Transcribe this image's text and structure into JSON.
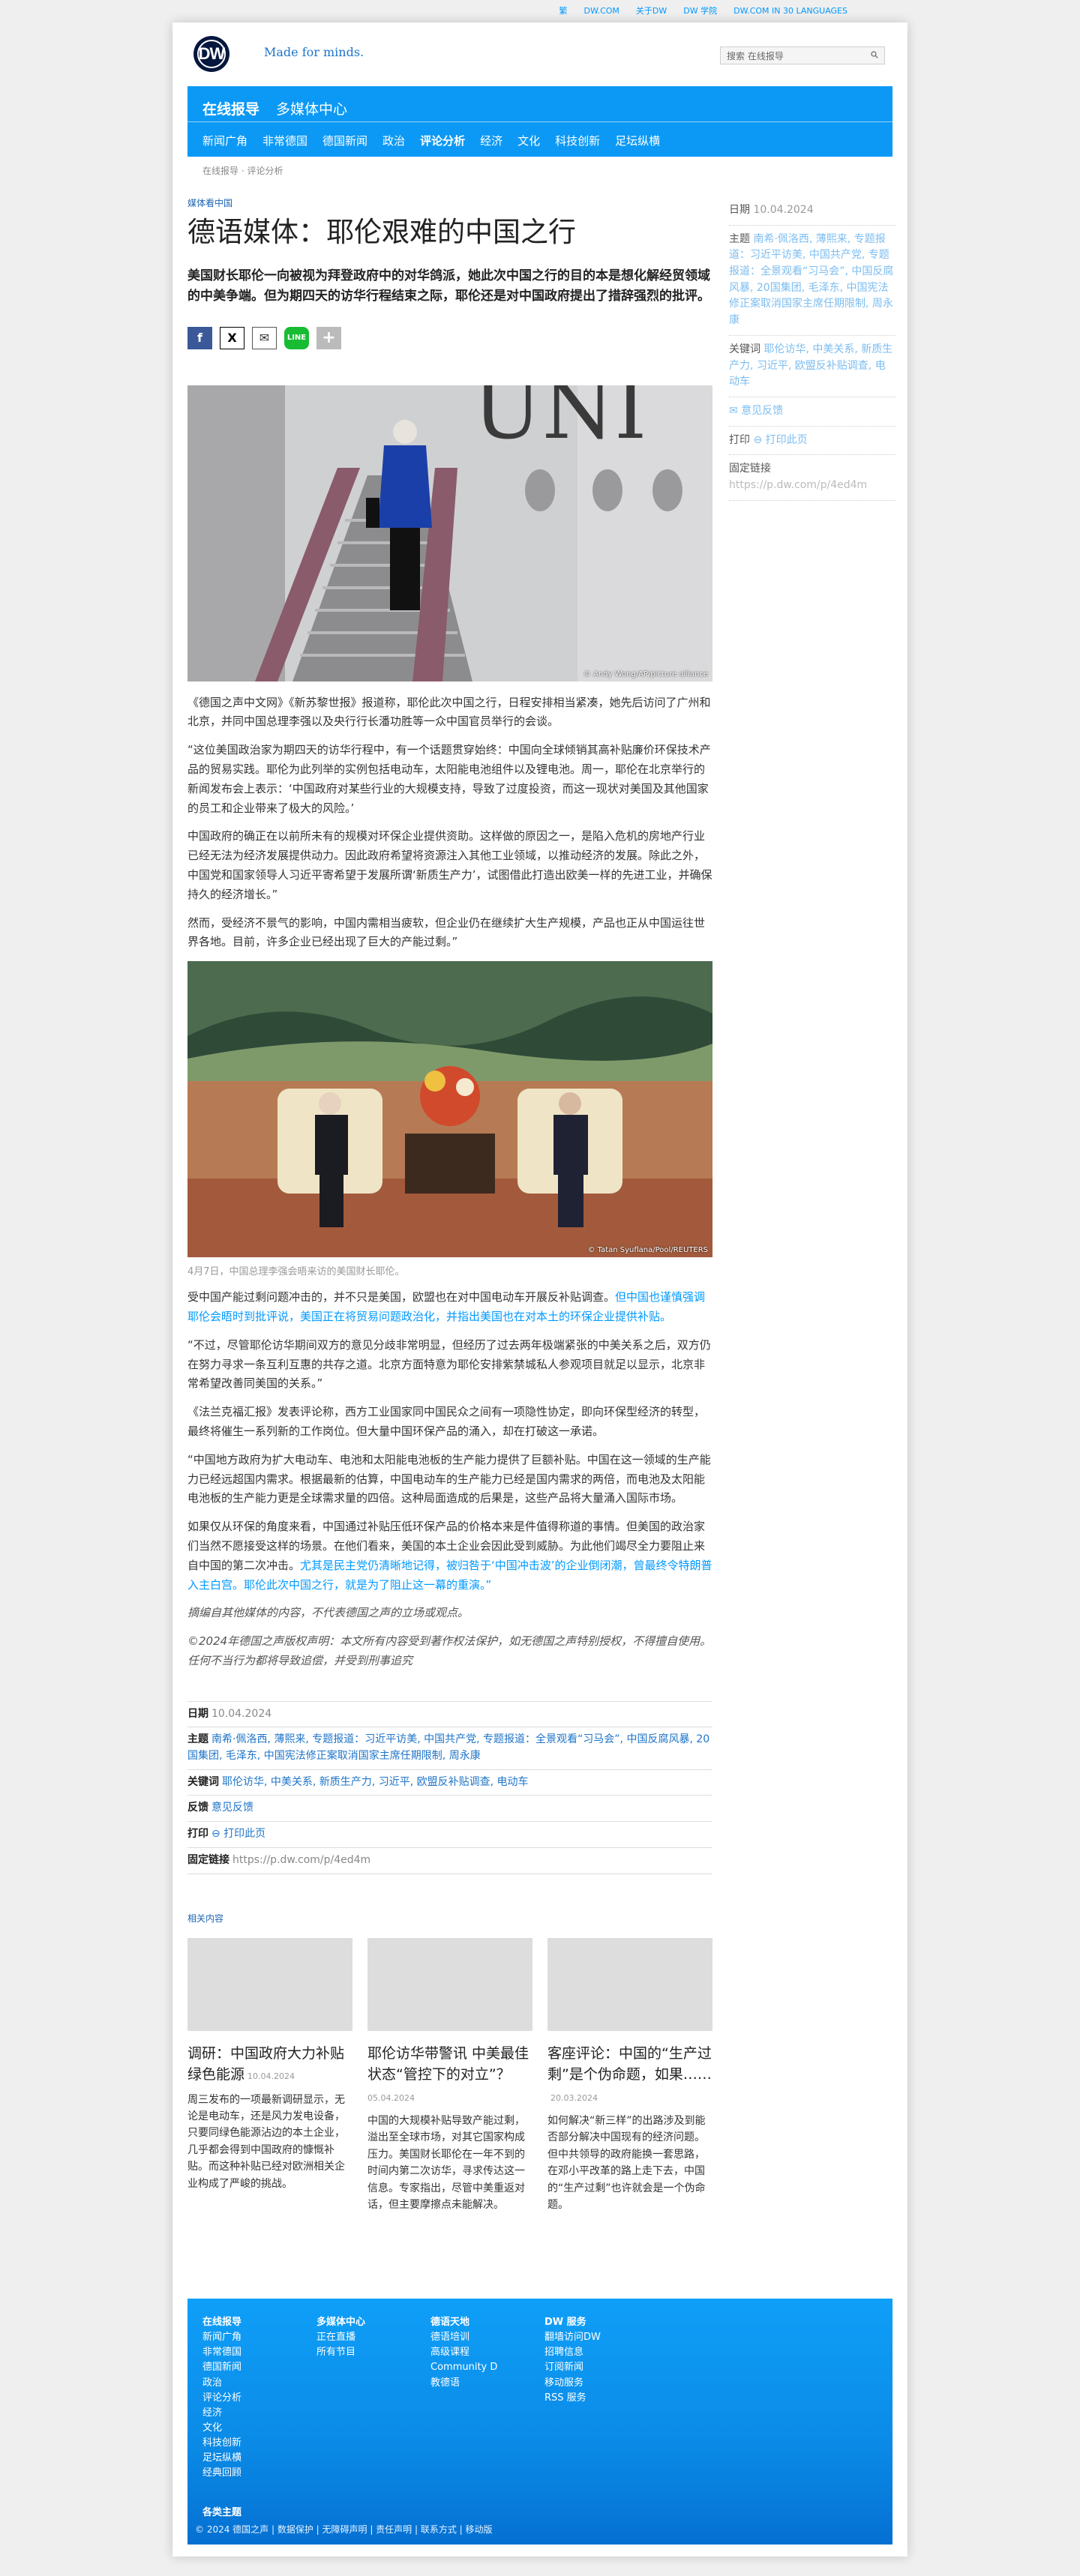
{
  "topbar": [
    "繁",
    "DW.COM",
    "关于DW",
    "DW 学院",
    "DW.COM IN 30 LANGUAGES"
  ],
  "header": {
    "slogan": "Made for minds.",
    "search_placeholder": "搜索 在线报导"
  },
  "nav": {
    "top": [
      "在线报导",
      "多媒体中心"
    ],
    "sub": [
      "新闻广角",
      "非常德国",
      "德国新闻",
      "政治",
      "评论分析",
      "经济",
      "文化",
      "科技创新",
      "足坛纵横"
    ]
  },
  "breadcrumb": "在线报导 · 评论分析",
  "article": {
    "kicker": "媒体看中国",
    "title": "德语媒体：耶伦艰难的中国之行",
    "lead": "美国财长耶伦一向被视为拜登政府中的对华鸽派，她此次中国之行的目的本是想化解经贸领域的中美争端。但为期四天的访华行程结束之际，耶伦还是对中国政府提出了措辞强烈的批评。",
    "photo1_credit": "© Andy Wong/AP/picture alliance",
    "p1": "《德国之声中文网》《新苏黎世报》报道称，耶伦此次中国之行，日程安排相当紧凑，她先后访问了广州和北京，并同中国总理李强以及央行行长潘功胜等一众中国官员举行的会谈。",
    "p2": "“这位美国政治家为期四天的访华行程中，有一个话题贯穿始终：中国向全球倾销其高补贴廉价环保技术产品的贸易实践。耶伦为此列举的实例包括电动车，太阳能电池组件以及锂电池。周一，耶伦在北京举行的新闻发布会上表示：‘中国政府对某些行业的大规模支持，导致了过度投资，而这一现状对美国及其他国家的员工和企业带来了极大的风险。’",
    "p3": "中国政府的确正在以前所未有的规模对环保企业提供资助。这样做的原因之一，是陷入危机的房地产行业已经无法为经济发展提供动力。因此政府希望将资源注入其他工业领域，以推动经济的发展。除此之外，中国党和国家领导人习近平寄希望于发展所谓‘新质生产力’，试图借此打造出欧美一样的先进工业，并确保持久的经济增长。”",
    "p4": "然而，受经济不景气的影响，中国内需相当疲软，但企业仍在继续扩大生产规模，产品也正从中国运往世界各地。目前，许多企业已经出现了巨大的产能过剩。”",
    "photo2_credit": "© Tatan Syuflana/Pool/REUTERS",
    "caption": "4月7日，中国总理李强会晤来访的美国财长耶伦。",
    "p5_a": "受中国产能过剩问题冲击的，并不只是美国，欧盟也在对中国电动车开展反补贴调查。",
    "p5_link": "但中国也谨慎强调耶伦会晤时到批评说，美国正在将贸易问题政治化，并指出美国也在对本土的环保企业提供补贴。",
    "p6": "“不过，尽管耶伦访华期间双方的意见分歧非常明显，但经历了过去两年极端紧张的中美关系之后，双方仍在努力寻求一条互利互惠的共存之道。北京方面特意为耶伦安排紫禁城私人参观项目就足以显示，北京非常希望改善同美国的关系。”",
    "p7": "《法兰克福汇报》发表评论称，西方工业国家同中国民众之间有一项隐性协定，即向环保型经济的转型，最终将催生一系列新的工作岗位。但大量中国环保产品的涌入，却在打破这一承诺。",
    "p8": "“中国地方政府为扩大电动车、电池和太阳能电池板的生产能力提供了巨额补贴。中国在这一领域的生产能力已经远超国内需求。根据最新的估算，中国电动车的生产能力已经是国内需求的两倍，而电池及太阳能电池板的生产能力更是全球需求量的四倍。这种局面造成的后果是，这些产品将大量涌入国际市场。",
    "p9_a": "如果仅从环保的角度来看，中国通过补贴压低环保产品的价格本来是件值得称道的事情。但美国的政治家们当然不愿接受这样的场景。在他们看来，美国的本土企业会因此受到威胁。为此他们竭尽全力要阻止来自中国的第二次冲击。",
    "p9_link": "尤其是民主党仍清晰地记得，被归咎于‘中国冲击波’的企业倒闭潮，曾最终令特朗普入主白宫。耶伦此次中国之行，就是为了阻止这一幕的重演。”",
    "note1": "摘编自其他媒体的内容，不代表德国之声的立场或观点。",
    "note2": "©2024年德国之声版权声明：本文所有内容受到著作权法保护，如无德国之声特别授权，不得擅自使用。任何不当行为都将导致追偿，并受到刑事追究"
  },
  "meta": {
    "date_label": "日期",
    "date": "10.04.2024",
    "topics_label": "主题",
    "topics": "南希·佩洛西, 薄熙来, 专题报道：习近平访美, 中国共产党, 专题报道：全景观看“习马会”, 中国反腐风暴, 20国集团, 毛泽东, 中国宪法修正案取消国家主席任期限制, 周永康",
    "keywords_label": "关键词",
    "keywords": "耶伦访华, 中美关系, 新质生产力, 习近平, 欧盟反补贴调查, 电动车",
    "feedback_label": "反馈",
    "feedback": "意见反馈",
    "print_label": "打印",
    "print": "打印此页",
    "link_label": "固定链接",
    "link": "https://p.dw.com/p/4ed4m"
  },
  "related": {
    "heading": "相关内容",
    "items": [
      {
        "title": "调研：中国政府大力补贴绿色能源",
        "date": "10.04.2024",
        "text": "周三发布的一项最新调研显示，无论是电动车，还是风力发电设备，只要同绿色能源沾边的本土企业，几乎都会得到中国政府的慷慨补贴。而这种补贴已经对欧洲相关企业构成了严峻的挑战。"
      },
      {
        "title": "耶伦访华带警讯 中美最佳状态“管控下的对立”？",
        "date": "05.04.2024",
        "text": "中国的大规模补贴导致产能过剩，溢出至全球市场，对其它国家构成压力。美国财长耶伦在一年不到的时间内第二次访华，寻求传达这一信息。专家指出，尽管中美重返对话，但主要摩擦点未能解决。"
      },
      {
        "title": "客座评论：中国的“生产过剩”是个伪命题，如果……",
        "date": "20.03.2024",
        "text": "如何解决“新三样”的出路涉及到能否部分解决中国现有的经济问题。但中共领导的政府能换一套思路，在邓小平改革的路上走下去，中国的“生产过剩”也许就会是一个伪命题。"
      }
    ]
  },
  "footer": {
    "cols": [
      {
        "title": "在线报导",
        "items": [
          "新闻广角",
          "非常德国",
          "德国新闻",
          "政治",
          "评论分析",
          "经济",
          "文化",
          "科技创新",
          "足坛纵横",
          "经典回顾"
        ]
      },
      {
        "title": "多媒体中心",
        "items": [
          "正在直播",
          "所有节目"
        ]
      },
      {
        "title": "德语天地",
        "items": [
          "德语培训",
          "高级课程",
          "Community D",
          "教德语"
        ]
      },
      {
        "title": "DW 服务",
        "items": [
          "翻墙访问DW",
          "招聘信息",
          "订阅新闻",
          "移动服务",
          "RSS 服务"
        ]
      }
    ],
    "extra": "各类主题",
    "copyright": "© 2024 德国之声 | 数据保护 | 无障碍声明 | 责任声明 | 联系方式 | 移动版"
  },
  "side": {
    "date_label": "日期",
    "date": "10.04.2024",
    "topics_label": "主题",
    "topics": "南希·佩洛西, 薄熙来, 专题报道：习近平访美, 中国共产党, 专题报道：全景观看“习马会”, 中国反腐风暴, 20国集团, 毛泽东, 中国宪法修正案取消国家主席任期限制, 周永康",
    "keywords_label": "关键词",
    "keywords": "耶伦访华, 中美关系, 新质生产力, 习近平, 欧盟反补贴调查, 电动车",
    "feedback": "意见反馈",
    "print_label": "打印",
    "print": "打印此页",
    "link_label": "固定链接",
    "link": "https://p.dw.com/p/4ed4m"
  }
}
